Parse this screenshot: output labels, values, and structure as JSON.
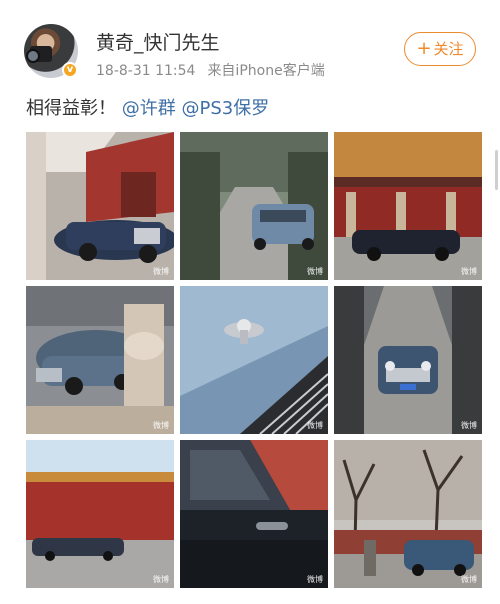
{
  "post": {
    "username": "黄奇_快门先生",
    "time": "18-8-31 11:54",
    "source": "来自iPhone客户端",
    "follow_label": "关注",
    "text_main": "相得益彰！",
    "mentions": [
      "@许群",
      "@PS3保罗"
    ]
  },
  "icons": {
    "avatar": "photographer-avatar",
    "verified": "verified-badge-icon",
    "follow": "plus-icon"
  },
  "colors": {
    "accent": "#ef8a2c",
    "mention": "#3f6fa7",
    "meta": "#8a8a8a"
  },
  "photos": [
    {
      "subject": "blue sedan by red palace wall"
    },
    {
      "subject": "sedan on tree-lined road, rear view"
    },
    {
      "subject": "sedan in front of palace hall"
    },
    {
      "subject": "sedan with stone railing foreground"
    },
    {
      "subject": "hood ornament close-up"
    },
    {
      "subject": "sedan front view on lane"
    },
    {
      "subject": "sedan side profile by red wall"
    },
    {
      "subject": "dark door panel close-up"
    },
    {
      "subject": "sedan under bare trees"
    }
  ]
}
